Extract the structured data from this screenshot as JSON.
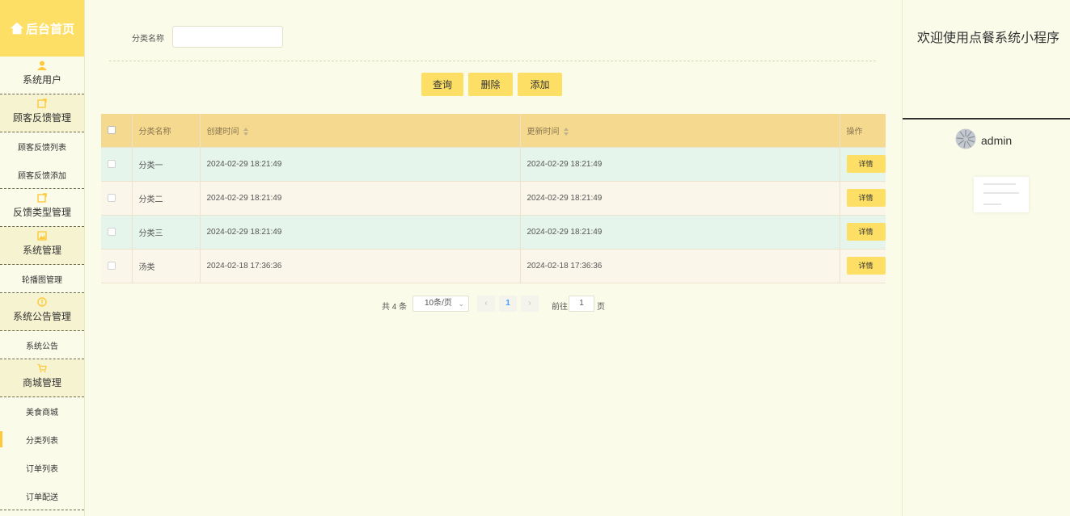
{
  "sidebar": {
    "home_label": "后台首页",
    "items": [
      {
        "label": "系统用户"
      },
      {
        "label": "顾客反馈管理"
      },
      {
        "label": "顾客反馈列表"
      },
      {
        "label": "顾客反馈添加"
      },
      {
        "label": "反馈类型管理"
      },
      {
        "label": "系统管理"
      },
      {
        "label": "轮播图管理"
      },
      {
        "label": "系统公告管理"
      },
      {
        "label": "系统公告"
      },
      {
        "label": "商城管理"
      },
      {
        "label": "美食商城"
      },
      {
        "label": "分类列表"
      },
      {
        "label": "订单列表"
      },
      {
        "label": "订单配送"
      }
    ],
    "active_item": "分类列表",
    "accent_color": "#fddf66",
    "icon_color": "#fdc93b"
  },
  "search": {
    "label": "分类名称",
    "value": "",
    "placeholder": ""
  },
  "buttons": {
    "query": "查询",
    "delete": "删除",
    "add": "添加"
  },
  "table": {
    "columns": [
      "分类名称",
      "创建时间",
      "更新时间",
      "操作"
    ],
    "rows": [
      {
        "name": "分类一",
        "created": "2024-02-29 18:21:49",
        "updated": "2024-02-29 18:21:49",
        "action": "详情"
      },
      {
        "name": "分类二",
        "created": "2024-02-29 18:21:49",
        "updated": "2024-02-29 18:21:49",
        "action": "详情"
      },
      {
        "name": "分类三",
        "created": "2024-02-29 18:21:49",
        "updated": "2024-02-29 18:21:49",
        "action": "详情"
      },
      {
        "name": "汤类",
        "created": "2024-02-18 17:36:36",
        "updated": "2024-02-18 17:36:36",
        "action": "详情"
      }
    ]
  },
  "pagination": {
    "total": "共 4 条",
    "page_size": "10条/页",
    "current_page": "1",
    "goto_label": "前往",
    "goto_value": "1",
    "page_unit": "页"
  },
  "right_panel": {
    "welcome": "欢迎使用点餐系统小程序",
    "username": "admin"
  }
}
